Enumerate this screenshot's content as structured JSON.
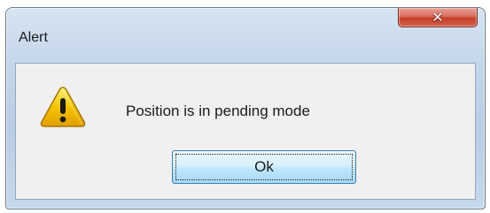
{
  "window": {
    "title": "Alert",
    "close_icon": "close-icon",
    "close_glyph": "✕"
  },
  "dialog": {
    "icon": "warning-icon",
    "message": "Position is in pending mode",
    "ok_label": "Ok"
  },
  "colors": {
    "close_button": "#c4402b",
    "ok_button_border": "#3c7fb1",
    "warning_yellow": "#f5c400"
  }
}
